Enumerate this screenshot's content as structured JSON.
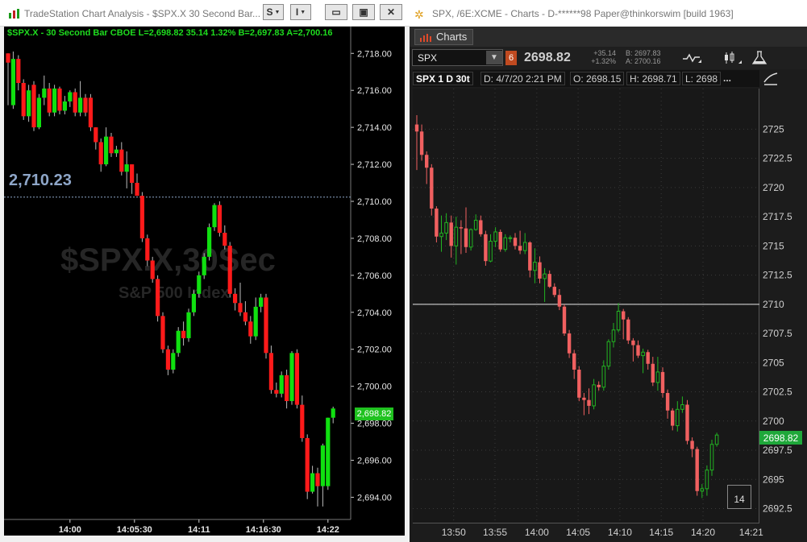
{
  "tradestation": {
    "window_title": "TradeStation Chart Analysis - $SPX.X 30 Second Bar...",
    "title_buttons": {
      "s": "S",
      "i": "I",
      "min": "▭",
      "max": "▣",
      "close": "✕"
    },
    "infobar": "$SPX.X - 30 Second Bar  CBOE  L=2,698.82  35.14  1.32%  B=2,697.83  A=2,700.16",
    "watermark_symbol": "$SPX.X,30Sec",
    "watermark_name": "S&P 500 Index",
    "last_label": "2,710.23",
    "last_price_badge": "2,698.82",
    "y_ticks": [
      "2,718.00",
      "2,716.00",
      "2,714.00",
      "2,712.00",
      "2,710.00",
      "2,708.00",
      "2,706.00",
      "2,704.00",
      "2,702.00",
      "2,700.00",
      "2,698.00",
      "2,696.00",
      "2,694.00"
    ],
    "x_ticks": [
      "14:00",
      "14:05:30",
      "14:11",
      "14:16:30",
      "14:22"
    ]
  },
  "thinkorswim": {
    "window_title": "SPX, /6E:XCME - Charts - D-******98 Paper@thinkorswim [build 1963]",
    "tab_label": "Charts",
    "symbol": "SPX",
    "link_badge": "6",
    "last_price": "2698.82",
    "net_change": "+35.14",
    "pct_change": "+1.32%",
    "bid": "B: 2697.83",
    "ask": "A: 2700.16",
    "header": {
      "symbol_period": "SPX 1 D 30t",
      "date": "D: 4/7/20 2:21 PM",
      "open": "O: 2698.15",
      "high": "H: 2698.71",
      "low": "L: 2698",
      "more": "..."
    },
    "price_badge": "2698.82",
    "count_box": "14",
    "y_ticks": [
      "2725",
      "2722.5",
      "2720",
      "2717.5",
      "2715",
      "2712.5",
      "2710",
      "2707.5",
      "2705",
      "2702.5",
      "2700",
      "2697.5",
      "2695",
      "2692.5"
    ],
    "x_ticks": [
      "13:50",
      "13:55",
      "14:00",
      "14:05",
      "14:10",
      "14:15",
      "14:20",
      "14:21"
    ]
  },
  "colors": {
    "up": "#10e010",
    "down": "#ff1a1a",
    "tos_up": "#22b422",
    "tos_down": "#f06060"
  },
  "chart_data": [
    {
      "type": "candlestick",
      "title": "",
      "ylim": [
        2692.8,
        2719.1
      ],
      "x_labels": [
        "14:00",
        "14:05:30",
        "14:11",
        "14:16:30",
        "14:22"
      ],
      "hline": 2710.23,
      "bars": [
        [
          2718.0,
          2717.5,
          2718.0,
          2715.2
        ],
        [
          2715.2,
          2717.7,
          2718.1,
          2715.0
        ],
        [
          2717.7,
          2716.4,
          2717.9,
          2716.0
        ],
        [
          2716.4,
          2714.6,
          2716.6,
          2714.4
        ],
        [
          2714.6,
          2716.0,
          2716.3,
          2714.3
        ],
        [
          2716.3,
          2714.0,
          2716.5,
          2713.8
        ],
        [
          2714.0,
          2715.6,
          2715.8,
          2713.9
        ],
        [
          2715.6,
          2716.1,
          2716.8,
          2715.2
        ],
        [
          2716.1,
          2714.8,
          2716.4,
          2714.6
        ],
        [
          2714.8,
          2716.1,
          2716.3,
          2714.6
        ],
        [
          2716.1,
          2714.9,
          2716.2,
          2714.7
        ],
        [
          2714.9,
          2715.4,
          2715.7,
          2714.7
        ],
        [
          2715.4,
          2715.9,
          2716.0,
          2715.1
        ],
        [
          2715.9,
          2714.8,
          2716.1,
          2714.6
        ],
        [
          2714.8,
          2715.6,
          2716.5,
          2714.6
        ],
        [
          2715.6,
          2714.8,
          2715.8,
          2714.6
        ],
        [
          2715.6,
          2714.0,
          2715.8,
          2713.8
        ],
        [
          2714.0,
          2713.2,
          2714.0,
          2712.8
        ],
        [
          2713.2,
          2712.0,
          2713.4,
          2711.6
        ],
        [
          2712.0,
          2713.5,
          2714.0,
          2711.9
        ],
        [
          2713.5,
          2712.6,
          2713.7,
          2712.4
        ],
        [
          2712.6,
          2712.8,
          2713.0,
          2712.4
        ],
        [
          2712.8,
          2711.6,
          2713.2,
          2711.4
        ],
        [
          2711.6,
          2712.0,
          2712.7,
          2710.7
        ],
        [
          2712.0,
          2711.0,
          2712.0,
          2710.4
        ],
        [
          2711.0,
          2710.3,
          2711.5,
          2710.3
        ],
        [
          2710.3,
          2708.0,
          2710.5,
          2707.8
        ],
        [
          2708.0,
          2706.8,
          2708.2,
          2706.5
        ],
        [
          2706.8,
          2705.8,
          2707.0,
          2705.6
        ],
        [
          2705.8,
          2703.8,
          2706.0,
          2703.5
        ],
        [
          2703.8,
          2702.0,
          2704.0,
          2701.8
        ],
        [
          2702.0,
          2700.9,
          2702.2,
          2700.6
        ],
        [
          2700.9,
          2701.8,
          2702.0,
          2700.7
        ],
        [
          2701.8,
          2703.0,
          2703.2,
          2701.6
        ],
        [
          2703.0,
          2702.6,
          2703.5,
          2702.2
        ],
        [
          2702.6,
          2704.0,
          2704.2,
          2702.4
        ],
        [
          2704.0,
          2705.0,
          2705.2,
          2703.8
        ],
        [
          2705.0,
          2706.0,
          2706.2,
          2704.8
        ],
        [
          2706.0,
          2707.0,
          2707.2,
          2705.8
        ],
        [
          2707.0,
          2708.6,
          2708.8,
          2706.8
        ],
        [
          2708.6,
          2709.8,
          2709.9,
          2708.4
        ],
        [
          2709.8,
          2708.3,
          2710.0,
          2708.1
        ],
        [
          2708.3,
          2707.6,
          2708.7,
          2707.4
        ],
        [
          2707.6,
          2705.0,
          2707.8,
          2704.8
        ],
        [
          2705.0,
          2704.5,
          2705.3,
          2704.1
        ],
        [
          2704.5,
          2704.0,
          2705.6,
          2703.8
        ],
        [
          2704.0,
          2703.5,
          2704.6,
          2703.3
        ],
        [
          2703.5,
          2702.7,
          2703.8,
          2702.3
        ],
        [
          2702.7,
          2704.3,
          2704.8,
          2702.5
        ],
        [
          2704.3,
          2704.8,
          2705.0,
          2704.0
        ],
        [
          2704.8,
          2701.8,
          2705.0,
          2701.5
        ],
        [
          2701.8,
          2699.8,
          2702.2,
          2699.6
        ],
        [
          2699.8,
          2699.6,
          2700.2,
          2699.4
        ],
        [
          2699.6,
          2700.6,
          2700.8,
          2699.4
        ],
        [
          2700.6,
          2699.2,
          2700.9,
          2698.8
        ],
        [
          2699.2,
          2701.8,
          2701.9,
          2699.0
        ],
        [
          2701.8,
          2699.0,
          2702.0,
          2698.8
        ],
        [
          2699.0,
          2697.2,
          2699.5,
          2697.0
        ],
        [
          2697.2,
          2694.3,
          2697.4,
          2693.9
        ],
        [
          2694.3,
          2695.3,
          2695.7,
          2694.2
        ],
        [
          2695.3,
          2694.6,
          2695.6,
          2693.5
        ],
        [
          2694.6,
          2696.8,
          2696.9,
          2693.5
        ],
        [
          2694.6,
          2698.3,
          2698.3,
          2694.4
        ],
        [
          2698.3,
          2698.8,
          2698.9,
          2698.0
        ]
      ]
    },
    {
      "type": "candlestick",
      "title": "",
      "ylim": [
        2691.5,
        2728.2
      ],
      "x_labels": [
        "13:50",
        "13:55",
        "14:00",
        "14:05",
        "14:10",
        "14:15",
        "14:20",
        "14:21"
      ],
      "hline": 2710.0,
      "bars": [
        [
          2725.4,
          2724.8,
          2726.2,
          2721.5
        ],
        [
          2724.8,
          2722.8,
          2725.4,
          2722.3
        ],
        [
          2722.8,
          2721.7,
          2723.1,
          2720.3
        ],
        [
          2721.7,
          2718.2,
          2722.0,
          2717.6
        ],
        [
          2718.2,
          2715.8,
          2718.4,
          2715.3
        ],
        [
          2715.8,
          2716.1,
          2717.6,
          2714.5
        ],
        [
          2716.1,
          2717.0,
          2717.8,
          2715.5
        ],
        [
          2717.0,
          2715.0,
          2717.6,
          2714.0
        ],
        [
          2715.0,
          2716.6,
          2717.5,
          2713.4
        ],
        [
          2716.6,
          2716.5,
          2717.2,
          2714.3
        ],
        [
          2716.5,
          2714.9,
          2718.3,
          2714.4
        ],
        [
          2714.9,
          2716.4,
          2716.5,
          2714.6
        ],
        [
          2716.4,
          2717.2,
          2717.7,
          2716.3
        ],
        [
          2717.2,
          2716.0,
          2717.6,
          2715.8
        ],
        [
          2716.0,
          2713.7,
          2716.3,
          2713.3
        ],
        [
          2713.7,
          2715.4,
          2716.0,
          2713.6
        ],
        [
          2715.4,
          2716.2,
          2716.6,
          2714.9
        ],
        [
          2716.2,
          2714.7,
          2716.4,
          2714.5
        ],
        [
          2714.7,
          2715.7,
          2716.0,
          2714.5
        ],
        [
          2715.7,
          2715.7,
          2715.9,
          2715.3
        ],
        [
          2715.7,
          2715.0,
          2716.1,
          2714.7
        ],
        [
          2715.0,
          2714.6,
          2716.3,
          2714.3
        ],
        [
          2714.6,
          2715.3,
          2716.1,
          2714.3
        ],
        [
          2715.3,
          2712.9,
          2715.4,
          2712.3
        ],
        [
          2712.9,
          2713.6,
          2714.8,
          2711.8
        ],
        [
          2713.6,
          2712.2,
          2714.1,
          2711.8
        ],
        [
          2712.2,
          2712.6,
          2713.1,
          2710.2
        ],
        [
          2712.6,
          2711.5,
          2712.9,
          2711.4
        ],
        [
          2711.5,
          2710.8,
          2711.8,
          2710.6
        ],
        [
          2710.8,
          2709.8,
          2711.3,
          2709.5
        ],
        [
          2709.8,
          2707.5,
          2710.0,
          2707.3
        ],
        [
          2707.5,
          2705.8,
          2707.8,
          2705.4
        ],
        [
          2705.8,
          2704.4,
          2706.1,
          2703.6
        ],
        [
          2704.4,
          2702.0,
          2704.7,
          2701.7
        ],
        [
          2702.0,
          2701.8,
          2702.4,
          2700.5
        ],
        [
          2701.8,
          2701.3,
          2702.8,
          2700.6
        ],
        [
          2701.3,
          2703.1,
          2703.6,
          2701.0
        ],
        [
          2703.1,
          2702.9,
          2703.4,
          2702.6
        ],
        [
          2702.9,
          2704.7,
          2705.2,
          2702.6
        ],
        [
          2704.7,
          2706.8,
          2707.0,
          2704.4
        ],
        [
          2706.8,
          2707.8,
          2708.4,
          2706.3
        ],
        [
          2707.8,
          2709.4,
          2710.1,
          2707.6
        ],
        [
          2709.4,
          2708.7,
          2709.6,
          2707.0
        ],
        [
          2708.7,
          2706.9,
          2708.9,
          2706.6
        ],
        [
          2706.9,
          2706.5,
          2707.1,
          2705.1
        ],
        [
          2706.5,
          2705.6,
          2706.9,
          2705.4
        ],
        [
          2705.6,
          2705.9,
          2706.2,
          2704.1
        ],
        [
          2705.9,
          2704.9,
          2706.1,
          2704.4
        ],
        [
          2704.9,
          2703.3,
          2705.5,
          2703.0
        ],
        [
          2703.3,
          2704.2,
          2705.5,
          2702.6
        ],
        [
          2704.2,
          2702.4,
          2704.6,
          2702.0
        ],
        [
          2702.4,
          2700.9,
          2702.7,
          2700.2
        ],
        [
          2700.9,
          2699.6,
          2701.1,
          2699.2
        ],
        [
          2699.6,
          2701.0,
          2701.7,
          2699.1
        ],
        [
          2701.0,
          2701.4,
          2702.1,
          2700.7
        ],
        [
          2701.4,
          2698.3,
          2701.8,
          2698.0
        ],
        [
          2698.3,
          2697.6,
          2698.6,
          2696.9
        ],
        [
          2697.6,
          2694.0,
          2697.8,
          2693.6
        ],
        [
          2694.0,
          2694.2,
          2694.6,
          2693.4
        ],
        [
          2694.2,
          2695.8,
          2696.2,
          2693.6
        ],
        [
          2695.8,
          2698.0,
          2698.4,
          2695.3
        ],
        [
          2698.0,
          2698.8,
          2699.0,
          2697.8
        ]
      ]
    }
  ]
}
